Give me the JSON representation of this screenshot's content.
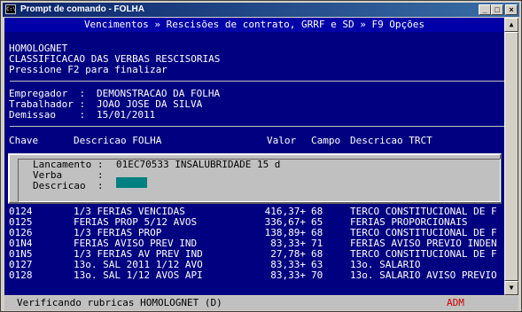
{
  "window": {
    "title": "Prompt de comando - FOLHA",
    "icon_text": "C:\\"
  },
  "topbar": {
    "text": "Vencimentos » Rescisões de contrato, GRRF e SD » F9 Opções"
  },
  "header": {
    "line1": "HOMOLOGNET",
    "line2": "CLASSIFICACAO DAS VERBAS RESCISORIAS",
    "line3": "Pressione F2 para finalizar"
  },
  "info": [
    {
      "label": "Empregador  :",
      "value": "DEMONSTRACAO DA FOLHA"
    },
    {
      "label": "Trabalhador :",
      "value": "JOAO JOSE DA SILVA"
    },
    {
      "label": "Demissao    :",
      "value": "15/01/2011"
    }
  ],
  "table": {
    "headers": {
      "chave": "Chave",
      "descricao": "Descricao FOLHA",
      "valor": "Valor",
      "campo": "Campo",
      "descricao_trct": "Descricao TRCT"
    },
    "hidden_chave_prefix": [
      "0",
      "0",
      "0",
      "0"
    ],
    "rows": [
      {
        "chave": "0124",
        "descricao": "1/3 FERIAS VENCIDAS",
        "valor": "416,37+",
        "campo": "68",
        "trct": "TERCO CONSTITUCIONAL DE F"
      },
      {
        "chave": "0125",
        "descricao": "FERIAS PROP 5/12 AVOS",
        "valor": "336,67+",
        "campo": "65",
        "trct": "FERIAS PROPORCIONAIS"
      },
      {
        "chave": "0126",
        "descricao": "1/3 FERIAS PROP",
        "valor": "138,89+",
        "campo": "68",
        "trct": "TERCO CONSTITUCIONAL DE F"
      },
      {
        "chave": "01N4",
        "descricao": "FERIAS AVISO PREV IND",
        "valor": "83,33+",
        "campo": "71",
        "trct": "FERIAS AVISO PREVIO INDEN"
      },
      {
        "chave": "01N5",
        "descricao": "1/3 FERIAS AV PREV IND",
        "valor": "27,78+",
        "campo": "68",
        "trct": "TERCO CONSTITUCIONAL DE F"
      },
      {
        "chave": "0127",
        "descricao": "13o. SAL 2011 1/12 AVO",
        "valor": "83,33+",
        "campo": "63",
        "trct": "13o. SALARIO"
      },
      {
        "chave": "0128",
        "descricao": "13o. SAL 1/12 AVOS API",
        "valor": "83,33+",
        "campo": "70",
        "trct": "13o. SALARIO AVISO PREVIO"
      }
    ]
  },
  "popup": {
    "lancamento_label": "Lancamento :",
    "lancamento_value": "01EC70533 INSALUBRIDADE 15 d",
    "verba_label": "Verba      :",
    "verba_value": "",
    "descricao_label": "Descricao  :"
  },
  "statusbar": {
    "left": "Verificando rubricas HOMOLOGNET (D)",
    "right": "ADM"
  },
  "colors": {
    "console_bg": "#000080",
    "text": "#ffffff",
    "input": "#008080",
    "status_right": "#cc0000"
  }
}
